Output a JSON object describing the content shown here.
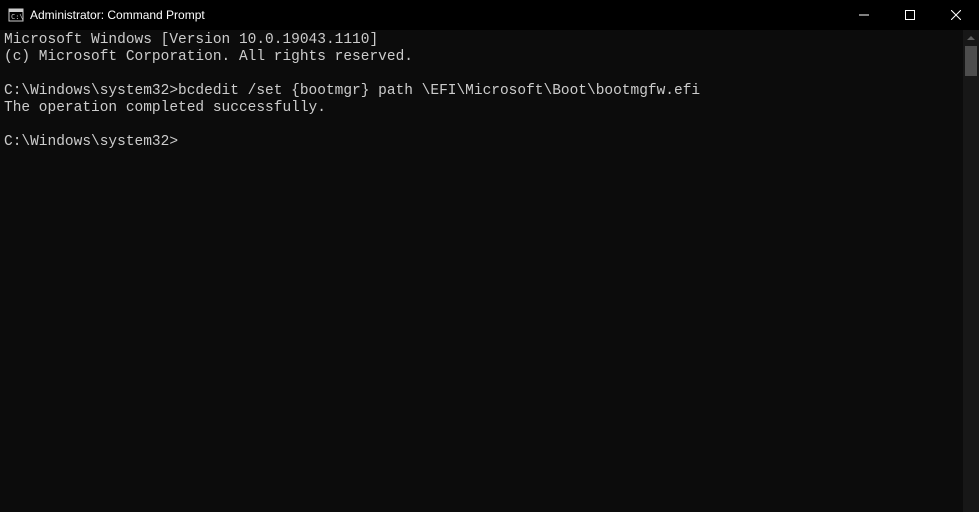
{
  "titlebar": {
    "title": "Administrator: Command Prompt"
  },
  "terminal": {
    "header_line1": "Microsoft Windows [Version 10.0.19043.1110]",
    "header_line2": "(c) Microsoft Corporation. All rights reserved.",
    "prompt1": "C:\\Windows\\system32>",
    "command1": "bcdedit /set {bootmgr} path \\EFI\\Microsoft\\Boot\\bootmgfw.efi",
    "result1": "The operation completed successfully.",
    "prompt2": "C:\\Windows\\system32>"
  }
}
